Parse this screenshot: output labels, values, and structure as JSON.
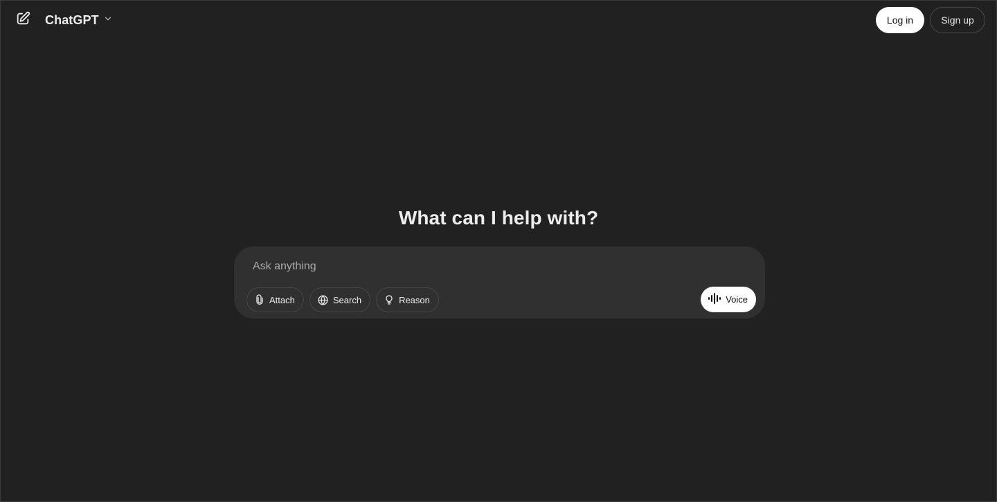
{
  "header": {
    "model_name": "ChatGPT",
    "login_label": "Log in",
    "signup_label": "Sign up"
  },
  "main": {
    "heading": "What can I help with?",
    "input_placeholder": "Ask anything",
    "input_value": "",
    "tools": [
      {
        "label": "Attach",
        "icon": "paperclip-icon"
      },
      {
        "label": "Search",
        "icon": "globe-icon"
      },
      {
        "label": "Reason",
        "icon": "lightbulb-icon"
      }
    ],
    "voice_label": "Voice"
  },
  "colors": {
    "background": "#212121",
    "composer": "#303030",
    "text": "#ececec",
    "primary_button": "#ffffff"
  }
}
